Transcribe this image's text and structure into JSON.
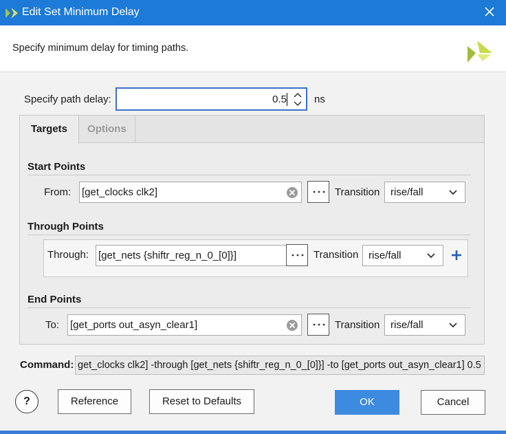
{
  "window": {
    "title": "Edit Set Minimum Delay"
  },
  "header": {
    "description": "Specify minimum delay for timing paths."
  },
  "delay": {
    "label": "Specify path delay:",
    "value": "0.5",
    "unit": "ns"
  },
  "tabs": [
    {
      "label": "Targets",
      "active": true
    },
    {
      "label": "Options",
      "active": false
    }
  ],
  "start_points": {
    "title": "Start Points",
    "from_label": "From:",
    "from_value": "[get_clocks clk2]",
    "transition_label": "Transition",
    "transition_value": "rise/fall"
  },
  "through_points": {
    "title": "Through Points",
    "through_label": "Through:",
    "through_value": "[get_nets {shiftr_reg_n_0_[0]}]",
    "transition_label": "Transition",
    "transition_value": "rise/fall"
  },
  "end_points": {
    "title": "End Points",
    "to_label": "To:",
    "to_value": "[get_ports out_asyn_clear1]",
    "transition_label": "Transition",
    "transition_value": "rise/fall"
  },
  "command": {
    "label": "Command:",
    "value": "get_clocks clk2] -through [get_nets {shiftr_reg_n_0_[0]}] -to [get_ports out_asyn_clear1] 0.5"
  },
  "buttons": {
    "help": "?",
    "reference": "Reference",
    "reset": "Reset to Defaults",
    "ok": "OK",
    "cancel": "Cancel"
  },
  "colors": {
    "title_bar": "#1d7ad6",
    "ok_button": "#3d8be0",
    "focus_border": "#3c6fc9"
  }
}
